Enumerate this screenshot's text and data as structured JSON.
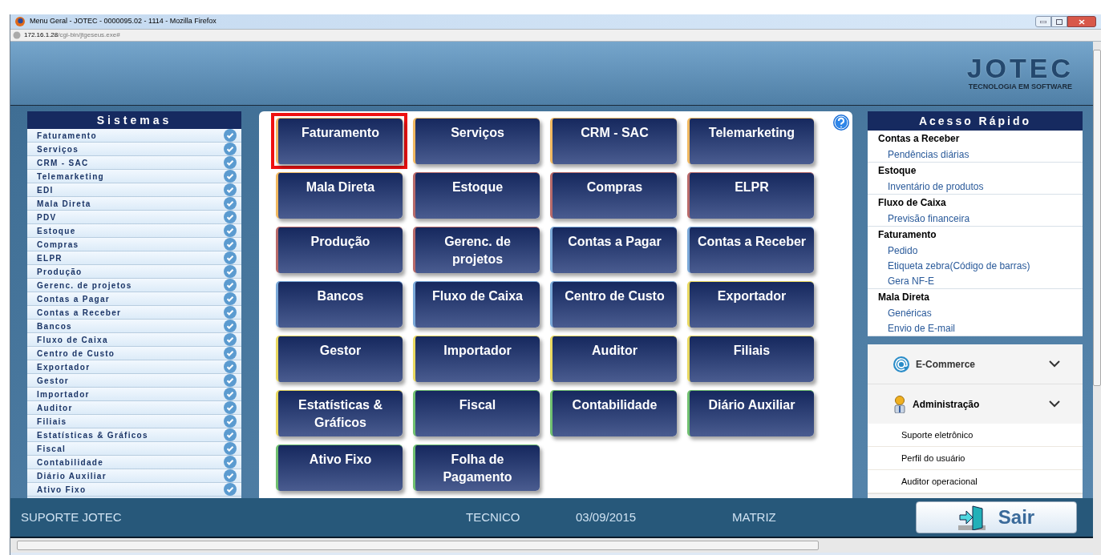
{
  "window": {
    "title": "Menu Geral - JOTEC - 0000095.02 - 1114 - Mozilla Firefox"
  },
  "address": {
    "host": "172.16.1.28",
    "path": "/cgi-bin/jtgeseus.exe#"
  },
  "logo": {
    "name": "JOTEC",
    "tagline": "TECNOLOGIA EM SOFTWARE"
  },
  "sidebar": {
    "title": "Sistemas",
    "items": [
      "Faturamento",
      "Serviços",
      "CRM - SAC",
      "Telemarketing",
      "EDI",
      "Mala Direta",
      "PDV",
      "Estoque",
      "Compras",
      "ELPR",
      "Produção",
      "Gerenc. de projetos",
      "Contas a Pagar",
      "Contas a Receber",
      "Bancos",
      "Fluxo de Caixa",
      "Centro de Custo",
      "Exportador",
      "Gestor",
      "Importador",
      "Auditor",
      "Filiais",
      "Estatísticas & Gráficos",
      "Fiscal",
      "Contabilidade",
      "Diário Auxiliar",
      "Ativo Fixo"
    ]
  },
  "modules": [
    {
      "label": "Faturamento",
      "color": "#f0b860",
      "selected": true
    },
    {
      "label": "Serviços",
      "color": "#f0b860",
      "selected": false
    },
    {
      "label": "CRM - SAC",
      "color": "#f0b860",
      "selected": false
    },
    {
      "label": "Telemarketing",
      "color": "#f0b860",
      "selected": false
    },
    {
      "label": "Mala Direta",
      "color": "#f0b860",
      "selected": false
    },
    {
      "label": "Estoque",
      "color": "#b86a6a",
      "selected": false
    },
    {
      "label": "Compras",
      "color": "#b86a6a",
      "selected": false
    },
    {
      "label": "ELPR",
      "color": "#b86a6a",
      "selected": false
    },
    {
      "label": "Produção",
      "color": "#b86a6a",
      "selected": false
    },
    {
      "label": "Gerenc. de projetos",
      "color": "#b86a6a",
      "selected": false
    },
    {
      "label": "Contas a Pagar",
      "color": "#7aa8d8",
      "selected": false
    },
    {
      "label": "Contas a Receber",
      "color": "#7aa8d8",
      "selected": false
    },
    {
      "label": "Bancos",
      "color": "#7aa8d8",
      "selected": false
    },
    {
      "label": "Fluxo de Caixa",
      "color": "#7aa8d8",
      "selected": false
    },
    {
      "label": "Centro de Custo",
      "color": "#7aa8d8",
      "selected": false
    },
    {
      "label": "Exportador",
      "color": "#e8d860",
      "selected": false
    },
    {
      "label": "Gestor",
      "color": "#e8d860",
      "selected": false
    },
    {
      "label": "Importador",
      "color": "#e8d860",
      "selected": false
    },
    {
      "label": "Auditor",
      "color": "#e8d860",
      "selected": false
    },
    {
      "label": "Filiais",
      "color": "#e8d860",
      "selected": false
    },
    {
      "label": "Estatísticas & Gráficos",
      "color": "#e8d860",
      "selected": false
    },
    {
      "label": "Fiscal",
      "color": "#70c070",
      "selected": false
    },
    {
      "label": "Contabilidade",
      "color": "#70c070",
      "selected": false
    },
    {
      "label": "Diário Auxiliar",
      "color": "#70c070",
      "selected": false
    },
    {
      "label": "Ativo Fixo",
      "color": "#70c070",
      "selected": false
    },
    {
      "label": "Folha de Pagamento",
      "color": "#70c070",
      "selected": false
    }
  ],
  "quick_access": {
    "title": "Acesso Rápido",
    "sections": [
      {
        "title": "Contas a Receber",
        "links": [
          "Pendências diárias"
        ]
      },
      {
        "title": "Estoque",
        "links": [
          "Inventário de produtos"
        ]
      },
      {
        "title": "Fluxo de Caixa",
        "links": [
          "Previsão financeira"
        ]
      },
      {
        "title": "Faturamento",
        "links": [
          "Pedido",
          "Etiqueta zebra(Código de barras)",
          "Gera NF-E"
        ]
      },
      {
        "title": "Mala Direta",
        "links": [
          "Genéricas",
          "Envio de E-mail"
        ]
      }
    ]
  },
  "accordion": [
    {
      "kind": "ecommerce",
      "title": "E-Commerce",
      "expanded": false
    },
    {
      "kind": "admin",
      "title": "Administração",
      "expanded": true,
      "items": [
        "Suporte eletrônico",
        "Perfil do usuário",
        "Auditor operacional"
      ]
    }
  ],
  "status_bar": {
    "user_group": "SUPORTE JOTEC",
    "user": "TECNICO",
    "date": "03/09/2015",
    "branch": "MATRIZ"
  },
  "exit_button": {
    "label": "Sair"
  }
}
